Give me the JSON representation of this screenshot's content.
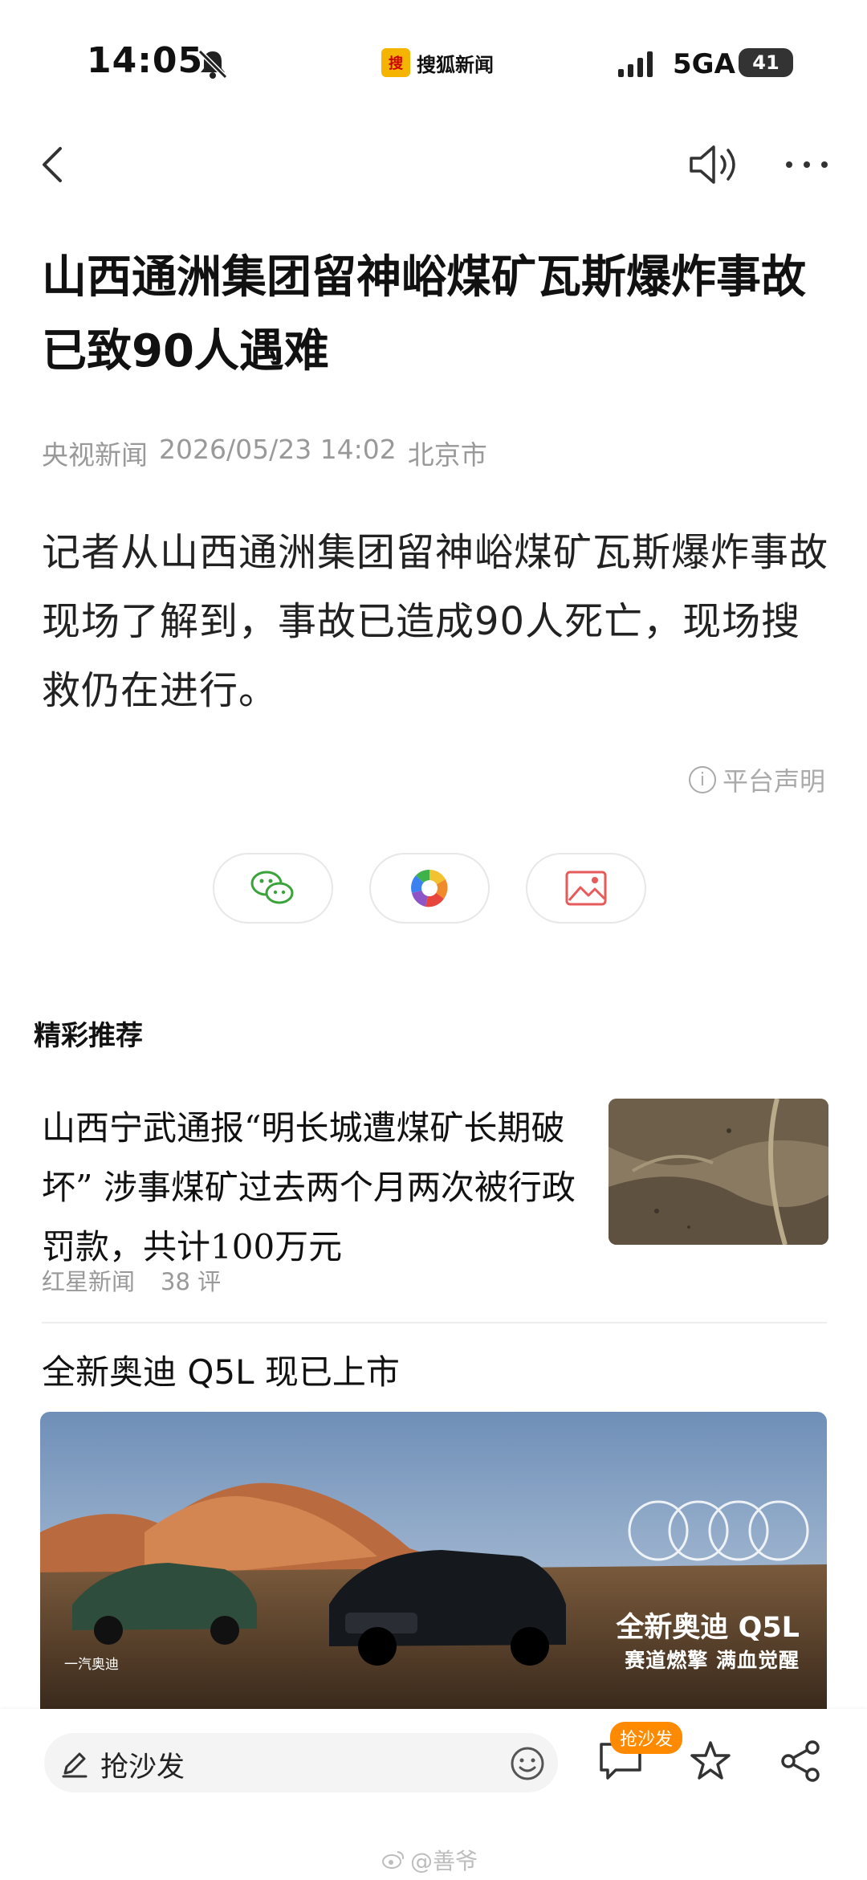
{
  "status_bar": {
    "time": "14:05",
    "app_name": "搜狐新闻",
    "app_logo_text": "搜",
    "network": "5GA",
    "battery": "41"
  },
  "article": {
    "title": "山西通洲集团留神峪煤矿瓦斯爆炸事故已致90人遇难",
    "source": "央视新闻",
    "datetime": "2026/05/23 14:02",
    "location": "北京市",
    "body": "记者从山西通洲集团留神峪煤矿瓦斯爆炸事故现场了解到，事故已造成90人死亡，现场搜救仍在进行。",
    "disclaimer": "平台声明"
  },
  "share": {
    "buttons": [
      "wechat-icon",
      "moments-icon",
      "image-icon"
    ]
  },
  "recommend": {
    "section_title": "精彩推荐",
    "item": {
      "title": "山西宁武通报“明长城遭煤矿长期破坏” 涉事煤矿过去两个月两次被行政罚款，共计100万元",
      "source": "红星新闻",
      "comments": "38 评"
    }
  },
  "ad": {
    "title": "全新奥迪 Q5L 现已上市",
    "image_brand": "全新奥迪 Q5L",
    "image_slogan": "赛道燃擎 满血觉醒",
    "image_left": "一汽奥迪"
  },
  "bottom_bar": {
    "comment_placeholder": "抢沙发",
    "sofa_badge": "抢沙发"
  },
  "watermark": "@善爷",
  "colors": {
    "accent_orange": "#ff8a00",
    "wechat_green": "#3aa33a",
    "image_red": "#e65a5a"
  }
}
